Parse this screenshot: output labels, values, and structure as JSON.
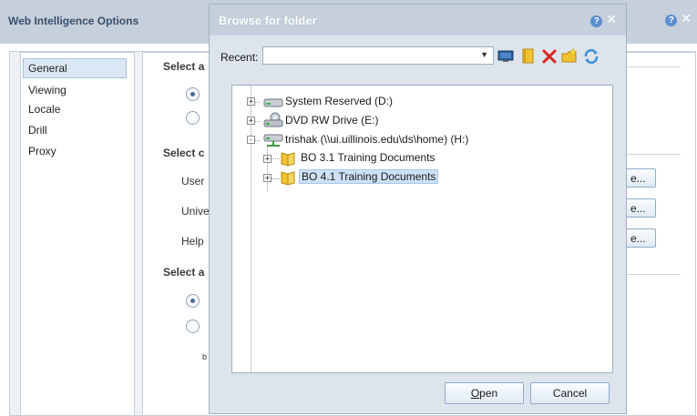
{
  "background_dialog": {
    "title": "Web Intelligence Options",
    "nav_items": [
      "General",
      "Viewing",
      "Locale",
      "Drill",
      "Proxy"
    ],
    "selected_nav": "General",
    "section1_heading": "Select a",
    "section2_heading": "Select c",
    "section3_heading": "Select a",
    "row_labels": [
      "User",
      "Unive",
      "Help"
    ],
    "right_button_label": "e...",
    "small_label": "b"
  },
  "dialog": {
    "title": "Browse for folder",
    "recent_label": "Recent:",
    "recent_value": "",
    "toolbar_icons": [
      "monitor-icon",
      "book-icon",
      "delete-icon",
      "new-folder-icon",
      "refresh-icon"
    ],
    "tree": [
      {
        "label": "System Reserved (D:)",
        "icon": "hard-drive-icon",
        "level": 0,
        "expander": "+"
      },
      {
        "label": "DVD RW Drive (E:)",
        "icon": "dvd-drive-icon",
        "level": 0,
        "expander": "+"
      },
      {
        "label": "trishak (\\\\ui.uillinois.edu\\ds\\home) (H:)",
        "icon": "network-drive-icon",
        "level": 0,
        "expander": "-"
      },
      {
        "label": "BO 3.1 Training Documents",
        "icon": "folder-icon",
        "level": 1,
        "expander": "+"
      },
      {
        "label": "BO 4.1 Training Documents",
        "icon": "folder-icon",
        "level": 1,
        "expander": "+",
        "selected": true
      }
    ],
    "open_label": "Open",
    "open_mnemonic": "O",
    "open_rest": "pen",
    "cancel_label": "Cancel"
  },
  "colors": {
    "title_bar": "#c5d0dc",
    "selection": "#cfe1f7",
    "delete_red": "#d9261c",
    "folder_yellow": "#f2c230"
  }
}
